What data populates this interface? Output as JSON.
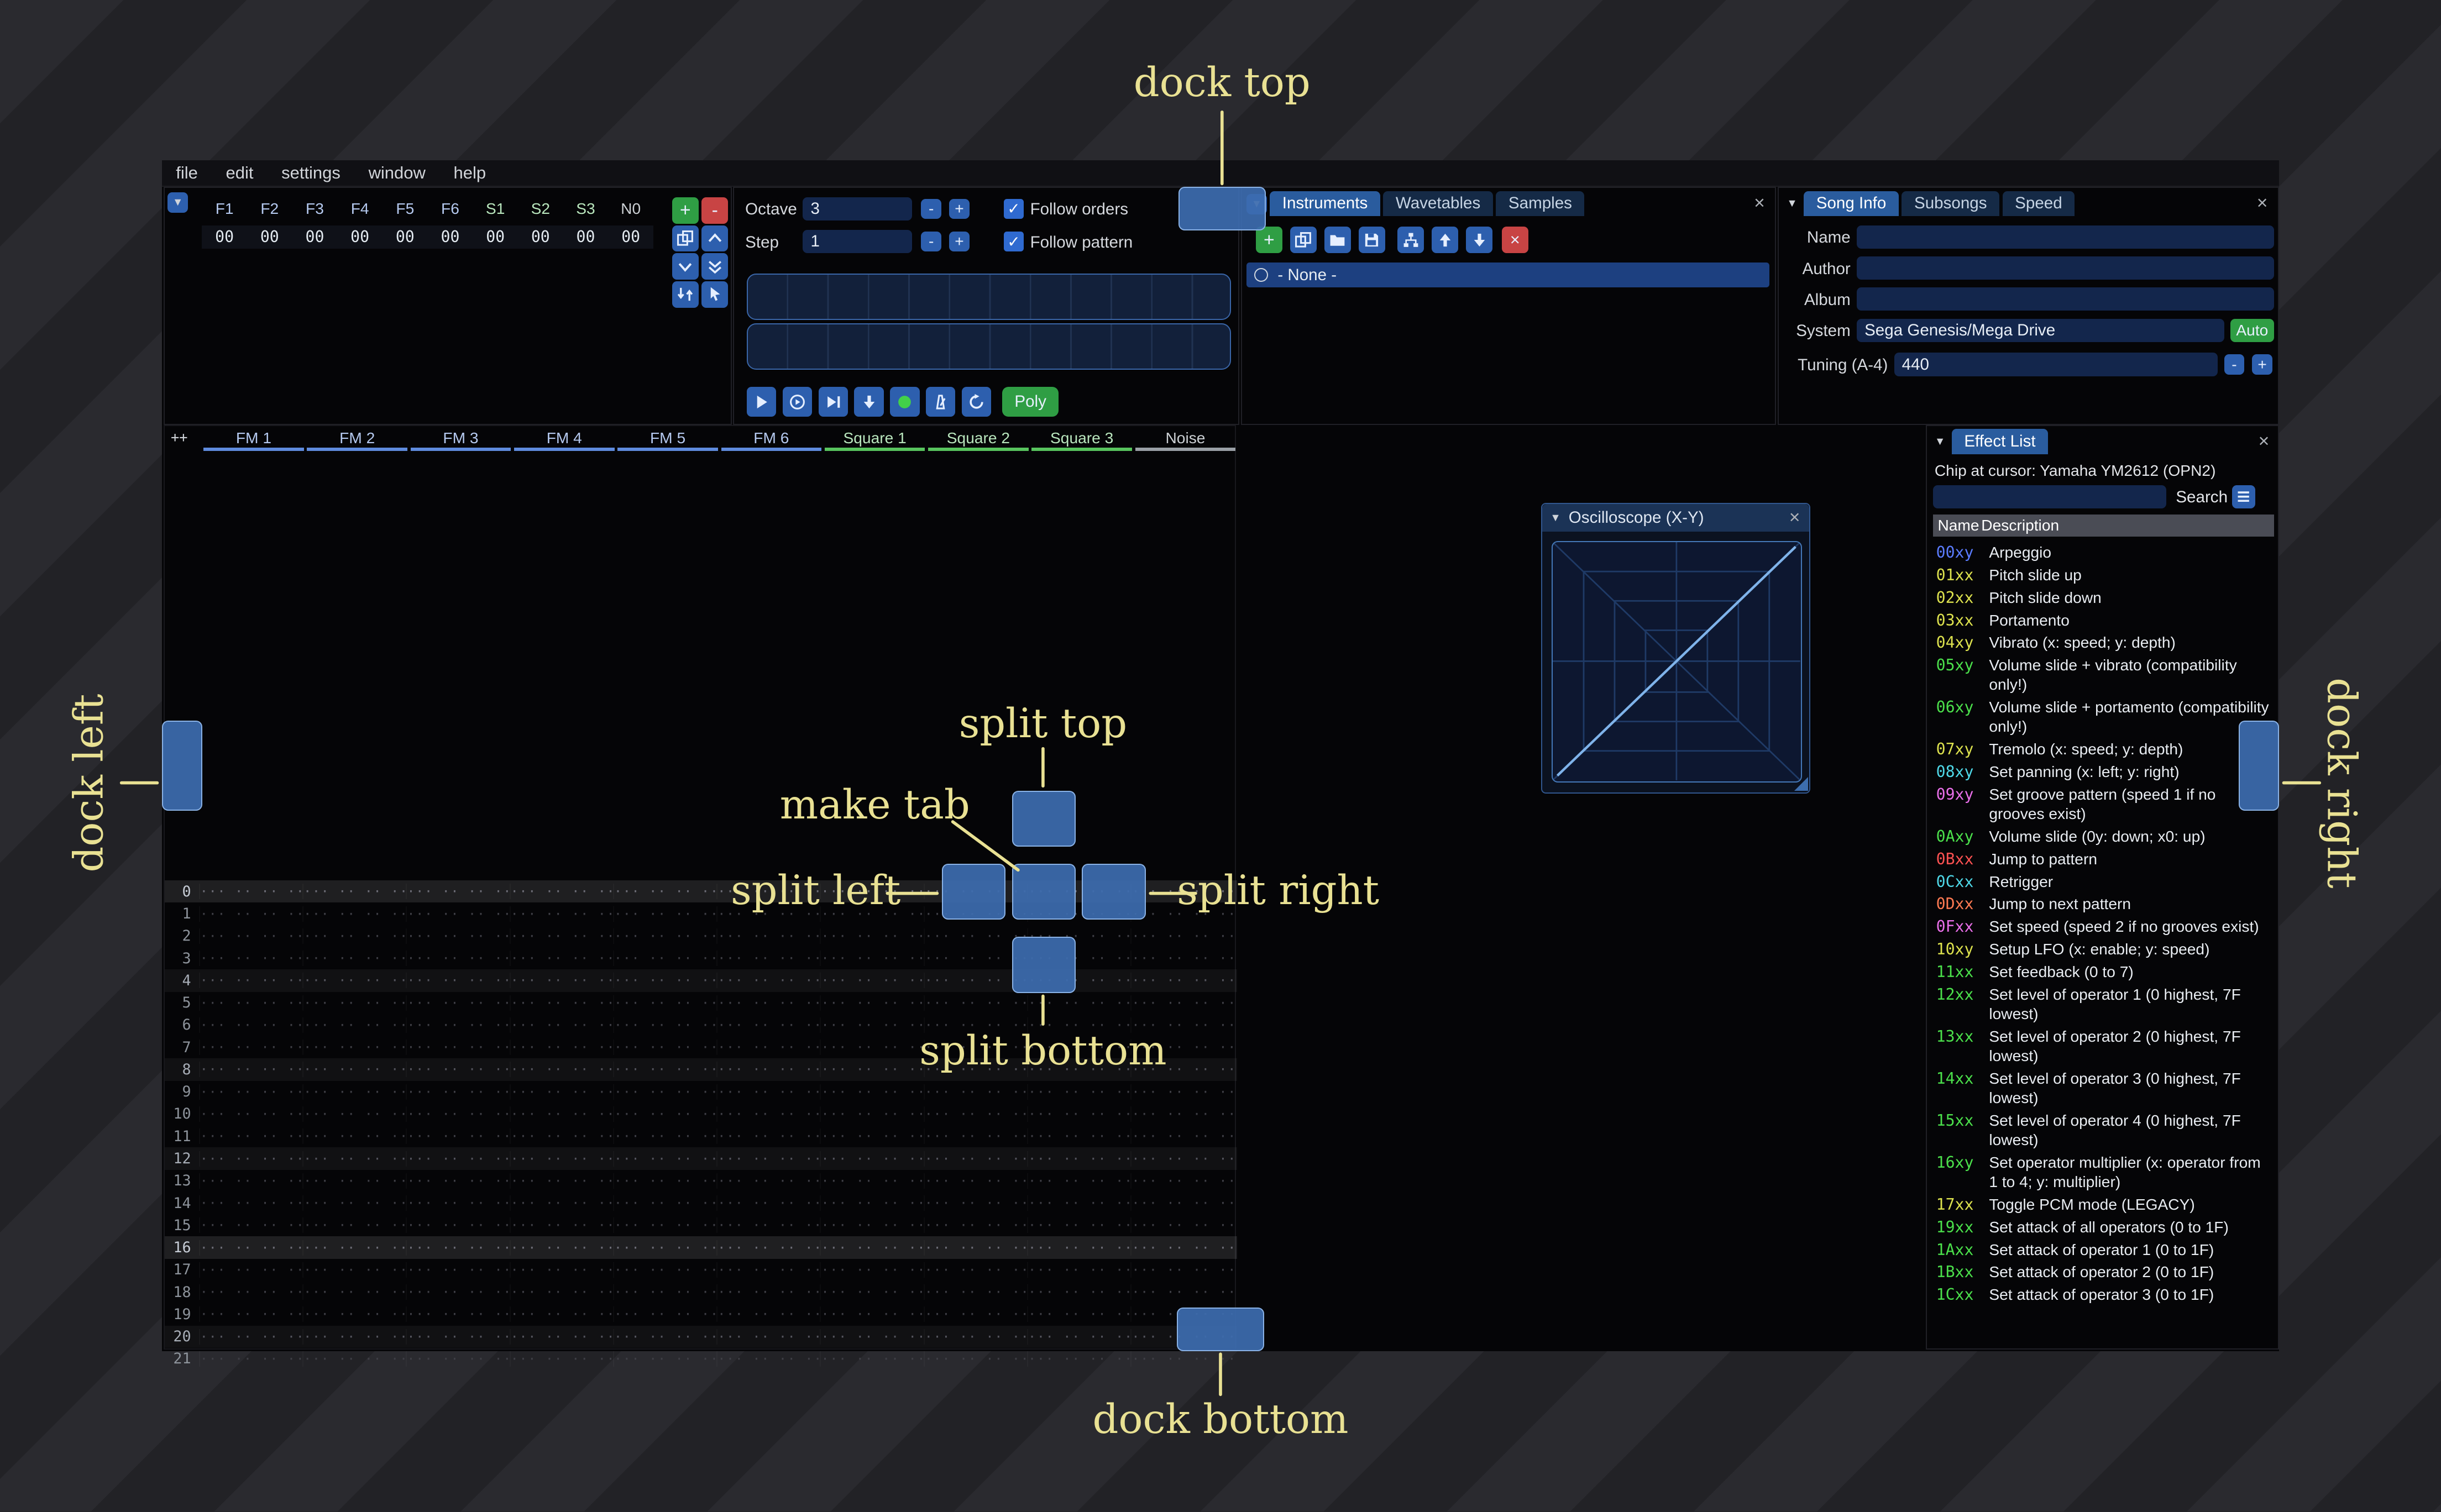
{
  "annotations": {
    "dock_top": "dock top",
    "dock_bottom": "dock bottom",
    "dock_left": "dock left",
    "dock_right": "dock right",
    "split_top": "split top",
    "split_bottom": "split bottom",
    "split_left": "split left",
    "split_right": "split right",
    "make_tab": "make tab",
    "color": "#e9e193"
  },
  "menu": {
    "items": [
      "file",
      "edit",
      "settings",
      "window",
      "help"
    ]
  },
  "orders": {
    "channels": [
      {
        "label": "F1",
        "color": "#b5c9ef"
      },
      {
        "label": "F2",
        "color": "#b5c9ef"
      },
      {
        "label": "F3",
        "color": "#b5c9ef"
      },
      {
        "label": "F4",
        "color": "#b5c9ef"
      },
      {
        "label": "F5",
        "color": "#b5c9ef"
      },
      {
        "label": "F6",
        "color": "#b5c9ef"
      },
      {
        "label": "S1",
        "color": "#b9e6bd"
      },
      {
        "label": "S2",
        "color": "#b9e6bd"
      },
      {
        "label": "S3",
        "color": "#b9e6bd"
      },
      {
        "label": "N0",
        "color": "#ccd0d4"
      }
    ],
    "row": [
      "00",
      "00",
      "00",
      "00",
      "00",
      "00",
      "00",
      "00",
      "00",
      "00"
    ]
  },
  "controls": {
    "octave_label": "Octave",
    "octave_value": "3",
    "step_label": "Step",
    "step_value": "1",
    "follow_orders": "Follow orders",
    "follow_pattern": "Follow pattern",
    "poly": "Poly"
  },
  "assets": {
    "tabs": [
      "Instruments",
      "Wavetables",
      "Samples"
    ],
    "active_tab": "Instruments",
    "items": [
      "- None -"
    ]
  },
  "song": {
    "tabs": [
      "Song Info",
      "Subsongs",
      "Speed"
    ],
    "active_tab": "Song Info",
    "fields": [
      {
        "label": "Name",
        "value": ""
      },
      {
        "label": "Author",
        "value": ""
      },
      {
        "label": "Album",
        "value": ""
      }
    ],
    "system_label": "System",
    "system_value": "Sega Genesis/Mega Drive",
    "auto_label": "Auto",
    "tuning_label": "Tuning (A-4)",
    "tuning_value": "440"
  },
  "pattern": {
    "corner": "++",
    "channels": [
      {
        "name": "FM 1",
        "color": "#5f8bdd",
        "text": "#b5c9ef"
      },
      {
        "name": "FM 2",
        "color": "#5f8bdd",
        "text": "#b5c9ef"
      },
      {
        "name": "FM 3",
        "color": "#5f8bdd",
        "text": "#b5c9ef"
      },
      {
        "name": "FM 4",
        "color": "#5f8bdd",
        "text": "#b5c9ef"
      },
      {
        "name": "FM 5",
        "color": "#5f8bdd",
        "text": "#b5c9ef"
      },
      {
        "name": "FM 6",
        "color": "#5f8bdd",
        "text": "#b5c9ef"
      },
      {
        "name": "Square 1",
        "color": "#58c45e",
        "text": "#b9e6bd"
      },
      {
        "name": "Square 2",
        "color": "#58c45e",
        "text": "#b9e6bd"
      },
      {
        "name": "Square 3",
        "color": "#58c45e",
        "text": "#b9e6bd"
      },
      {
        "name": "Noise",
        "color": "#9aa0a6",
        "text": "#ccd0d4"
      }
    ],
    "rows": [
      0,
      1,
      2,
      3,
      4,
      5,
      6,
      7,
      8,
      9,
      10,
      11,
      12,
      13,
      14,
      15,
      16,
      17,
      18,
      19,
      20,
      21
    ],
    "empty_cell": "··· ·· ·· ···"
  },
  "oscilloscope": {
    "title": "Oscilloscope (X-Y)"
  },
  "effects": {
    "tab": "Effect List",
    "chip": "Chip at cursor: Yamaha YM2612 (OPN2)",
    "search_label": "Search",
    "columns": [
      "Name",
      "Description"
    ],
    "items": [
      {
        "code": "00xy",
        "color": "#5b7cff",
        "desc": "Arpeggio"
      },
      {
        "code": "01xx",
        "color": "#dde24e",
        "desc": "Pitch slide up"
      },
      {
        "code": "02xx",
        "color": "#dde24e",
        "desc": "Pitch slide down"
      },
      {
        "code": "03xx",
        "color": "#dde24e",
        "desc": "Portamento"
      },
      {
        "code": "04xy",
        "color": "#dde24e",
        "desc": "Vibrato (x: speed; y: depth)"
      },
      {
        "code": "05xy",
        "color": "#4be04b",
        "desc": "Volume slide + vibrato (compatibility only!)"
      },
      {
        "code": "06xy",
        "color": "#4be04b",
        "desc": "Volume slide + portamento (compatibility only!)"
      },
      {
        "code": "07xy",
        "color": "#dde24e",
        "desc": "Tremolo (x: speed; y: depth)"
      },
      {
        "code": "08xy",
        "color": "#4fd8e8",
        "desc": "Set panning (x: left; y: right)"
      },
      {
        "code": "09xy",
        "color": "#e96fe9",
        "desc": "Set groove pattern (speed 1 if no grooves exist)"
      },
      {
        "code": "0Axy",
        "color": "#4be04b",
        "desc": "Volume slide (0y: down; x0: up)"
      },
      {
        "code": "0Bxx",
        "color": "#ff5252",
        "desc": "Jump to pattern"
      },
      {
        "code": "0Cxx",
        "color": "#4fd8e8",
        "desc": "Retrigger"
      },
      {
        "code": "0Dxx",
        "color": "#ff7a52",
        "desc": "Jump to next pattern"
      },
      {
        "code": "0Fxx",
        "color": "#e96fe9",
        "desc": "Set speed (speed 2 if no grooves exist)"
      },
      {
        "code": "10xy",
        "color": "#dde24e",
        "desc": "Setup LFO (x: enable; y: speed)"
      },
      {
        "code": "11xx",
        "color": "#4be04b",
        "desc": "Set feedback (0 to 7)"
      },
      {
        "code": "12xx",
        "color": "#4be04b",
        "desc": "Set level of operator 1 (0 highest, 7F lowest)"
      },
      {
        "code": "13xx",
        "color": "#4be04b",
        "desc": "Set level of operator 2 (0 highest, 7F lowest)"
      },
      {
        "code": "14xx",
        "color": "#4be04b",
        "desc": "Set level of operator 3 (0 highest, 7F lowest)"
      },
      {
        "code": "15xx",
        "color": "#4be04b",
        "desc": "Set level of operator 4 (0 highest, 7F lowest)"
      },
      {
        "code": "16xy",
        "color": "#4be04b",
        "desc": "Set operator multiplier (x: operator from 1 to 4; y: multiplier)"
      },
      {
        "code": "17xx",
        "color": "#dde24e",
        "desc": "Toggle PCM mode (LEGACY)"
      },
      {
        "code": "19xx",
        "color": "#4be04b",
        "desc": "Set attack of all operators (0 to 1F)"
      },
      {
        "code": "1Axx",
        "color": "#4be04b",
        "desc": "Set attack of operator 1 (0 to 1F)"
      },
      {
        "code": "1Bxx",
        "color": "#4be04b",
        "desc": "Set attack of operator 2 (0 to 1F)"
      },
      {
        "code": "1Cxx",
        "color": "#4be04b",
        "desc": "Set attack of operator 3 (0 to 1F)"
      }
    ]
  },
  "ui": {
    "close": "×",
    "collapse": "▼",
    "minus": "-",
    "plus": "+",
    "check": "✓"
  }
}
